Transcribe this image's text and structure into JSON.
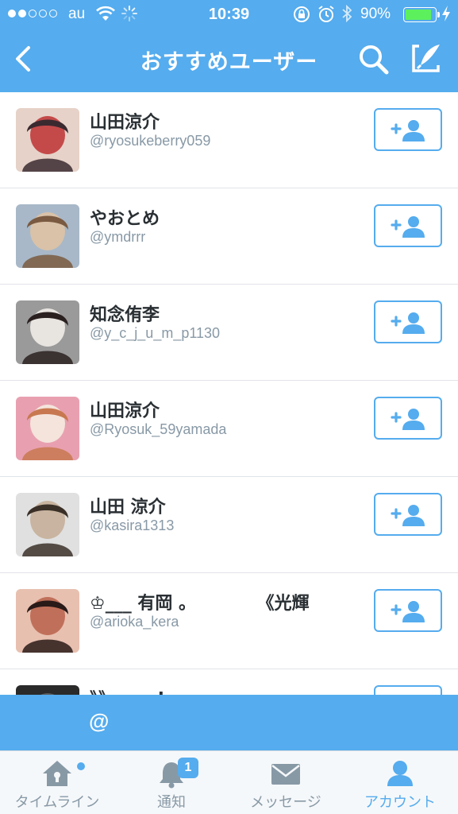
{
  "status_bar": {
    "carrier": "au",
    "time": "10:39",
    "battery_percent_text": "90%",
    "battery_level": 0.9,
    "signal_bars_filled": 2,
    "signal_bars_total": 5
  },
  "nav": {
    "title": "おすすめユーザー",
    "back_icon": "chevron-left-icon",
    "search_icon": "search-icon",
    "compose_icon": "compose-icon"
  },
  "users": [
    {
      "name": "山田涼介",
      "handle": "@ryosukeberry059",
      "avatar_colors": [
        "#3a2a30",
        "#c44a4a",
        "#e6d2c8"
      ]
    },
    {
      "name": "やおとめ",
      "handle": "@ymdrrr",
      "avatar_colors": [
        "#7a5a40",
        "#d9c2a8",
        "#a8b8c8"
      ]
    },
    {
      "name": "知念侑李",
      "handle": "@y_c_j_u_m_p1130",
      "avatar_colors": [
        "#2a2020",
        "#e8e4e0",
        "#9a9a9a"
      ]
    },
    {
      "name": "山田涼介",
      "handle": "@Ryosuk_59yamada",
      "avatar_colors": [
        "#c87850",
        "#f4e4dc",
        "#e8a0b0"
      ]
    },
    {
      "name": "山田 涼介",
      "handle": "@kasira1313",
      "avatar_colors": [
        "#3a3028",
        "#c8b4a0",
        "#e0e0e0"
      ]
    },
    {
      "name": "♔___ 有岡 。          《光輝",
      "handle": "@arioka_kera",
      "avatar_colors": [
        "#2a1a18",
        "#c0705a",
        "#e8c0b0"
      ]
    },
    {
      "name": "》》 ymd",
      "handle": "",
      "avatar_colors": [
        "#1a1a1a",
        "#5a5a5a",
        "#2a2a2a"
      ]
    }
  ],
  "follow_icon": "follow-user-icon",
  "compose_bar": {
    "at_label": "@"
  },
  "tabs": [
    {
      "label": "タイムライン",
      "icon": "home-icon",
      "active": false,
      "dot": true
    },
    {
      "label": "通知",
      "icon": "bell-icon",
      "active": false,
      "badge": "1"
    },
    {
      "label": "メッセージ",
      "icon": "envelope-icon",
      "active": false
    },
    {
      "label": "アカウント",
      "icon": "person-icon",
      "active": true
    }
  ],
  "colors": {
    "brand": "#55acee",
    "text_primary": "#292f33",
    "text_secondary": "#8899a6",
    "tab_inactive": "#8899a6"
  }
}
